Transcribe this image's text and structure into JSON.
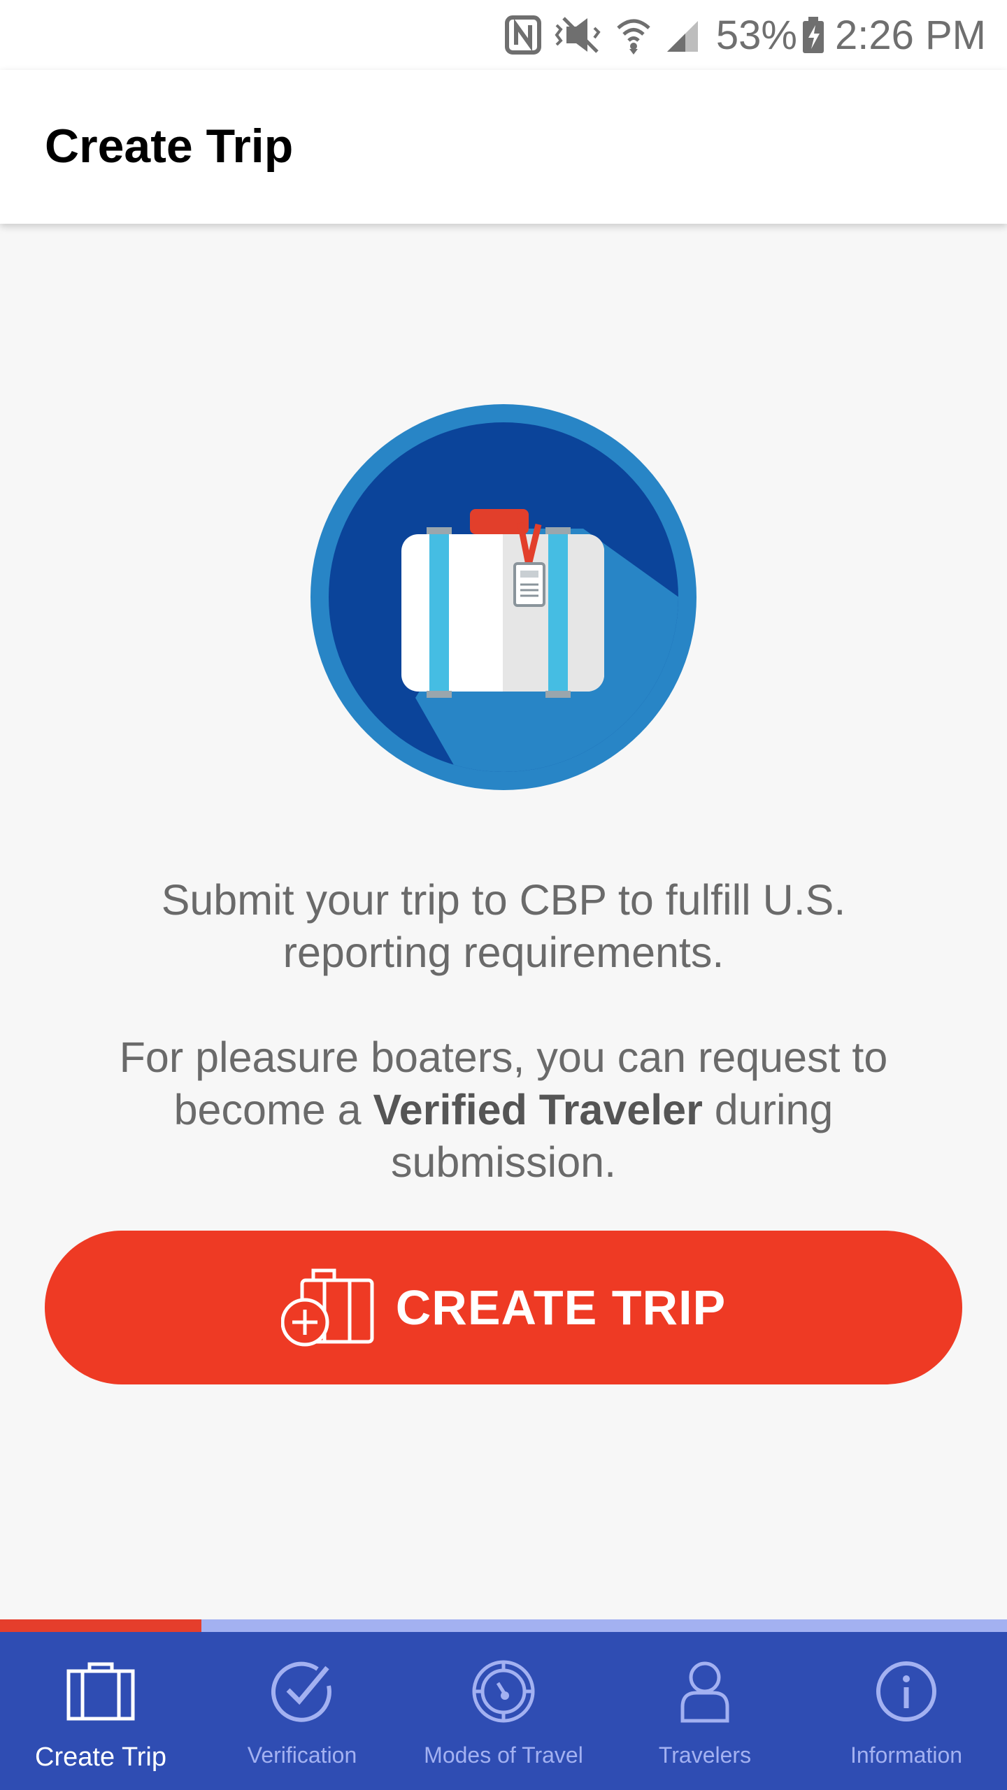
{
  "status_bar": {
    "battery": "53%",
    "time": "2:26 PM",
    "icons": [
      "nfc-icon",
      "vibrate-icon",
      "wifi-icon",
      "signal-icon",
      "battery-icon"
    ]
  },
  "app_bar": {
    "title": "Create Trip"
  },
  "hero": {
    "icon": "suitcase-icon"
  },
  "intro": {
    "line1": "Submit your trip to CBP to fulfill U.S. reporting requirements.",
    "line2_prefix": "For pleasure boaters, you can request to become a",
    "line2_bold": "Verified Traveler",
    "line2_suffix": "during submission."
  },
  "cta": {
    "label": "CREATE TRIP",
    "icon": "add-luggage-icon"
  },
  "progress": {
    "fraction": 0.2
  },
  "bottom_nav": {
    "items": [
      {
        "label": "Create Trip",
        "icon": "suitcase-icon",
        "active": true
      },
      {
        "label": "Verification",
        "icon": "check-circle-icon",
        "active": false
      },
      {
        "label": "Modes of Travel",
        "icon": "compass-icon",
        "active": false
      },
      {
        "label": "Travelers",
        "icon": "person-icon",
        "active": false
      },
      {
        "label": "Information",
        "icon": "info-icon",
        "active": false
      }
    ]
  },
  "colors": {
    "accent_red": "#ee3a24",
    "nav_blue": "#2f4db3",
    "nav_inactive": "#a3b1f1",
    "hero_dark_blue": "#0b449a",
    "hero_light_blue": "#2885c6"
  }
}
